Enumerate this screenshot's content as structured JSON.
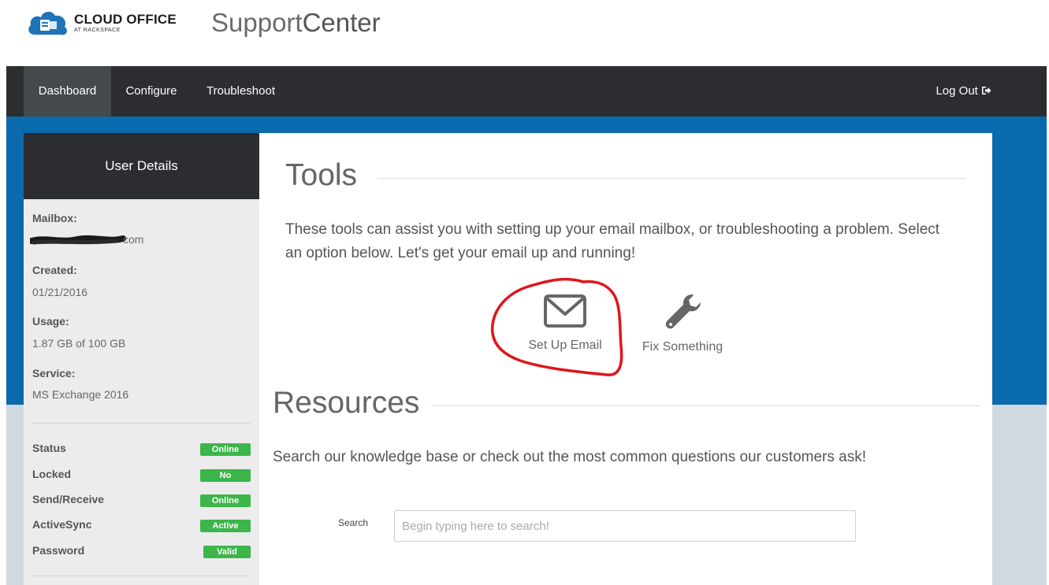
{
  "brand": {
    "logo_line1": "CLOUD OFFICE",
    "logo_line2": "AT RACKSPACE",
    "app_title_part1": "Support",
    "app_title_part2": "Center"
  },
  "nav": {
    "items": [
      {
        "label": "Dashboard",
        "active": true
      },
      {
        "label": "Configure",
        "active": false
      },
      {
        "label": "Troubleshoot",
        "active": false
      }
    ],
    "logout_label": "Log Out"
  },
  "sidebar": {
    "title": "User Details",
    "mailbox_label": "Mailbox:",
    "mailbox_value_visible": "com",
    "created_label": "Created:",
    "created_value": "01/21/2016",
    "usage_label": "Usage:",
    "usage_value": "1.87 GB of 100 GB",
    "service_label": "Service:",
    "service_value": "MS Exchange 2016",
    "statuses": [
      {
        "label": "Status",
        "badge": "Online"
      },
      {
        "label": "Locked",
        "badge": "No"
      },
      {
        "label": "Send/Receive",
        "badge": "Online"
      },
      {
        "label": "ActiveSync",
        "badge": "Active"
      },
      {
        "label": "Password",
        "badge": "Valid"
      }
    ]
  },
  "tools": {
    "title": "Tools",
    "description": "These tools can assist you with setting up your email mailbox, or troubleshooting a problem. Select an option below. Let's get your email up and running!",
    "items": [
      {
        "label": "Set Up Email",
        "icon": "envelope-icon"
      },
      {
        "label": "Fix Something",
        "icon": "wrench-icon"
      }
    ]
  },
  "resources": {
    "title": "Resources",
    "description": "Search our knowledge base or check out the most common questions our customers ask!",
    "search_label": "Search",
    "search_placeholder": "Begin typing here to search!",
    "search_value": ""
  },
  "colors": {
    "navbar": "#2b2d30",
    "nav_active": "#45484c",
    "blue_band": "#0a6aae",
    "badge_green": "#3cb54a",
    "annotation_red": "#e0151b"
  }
}
